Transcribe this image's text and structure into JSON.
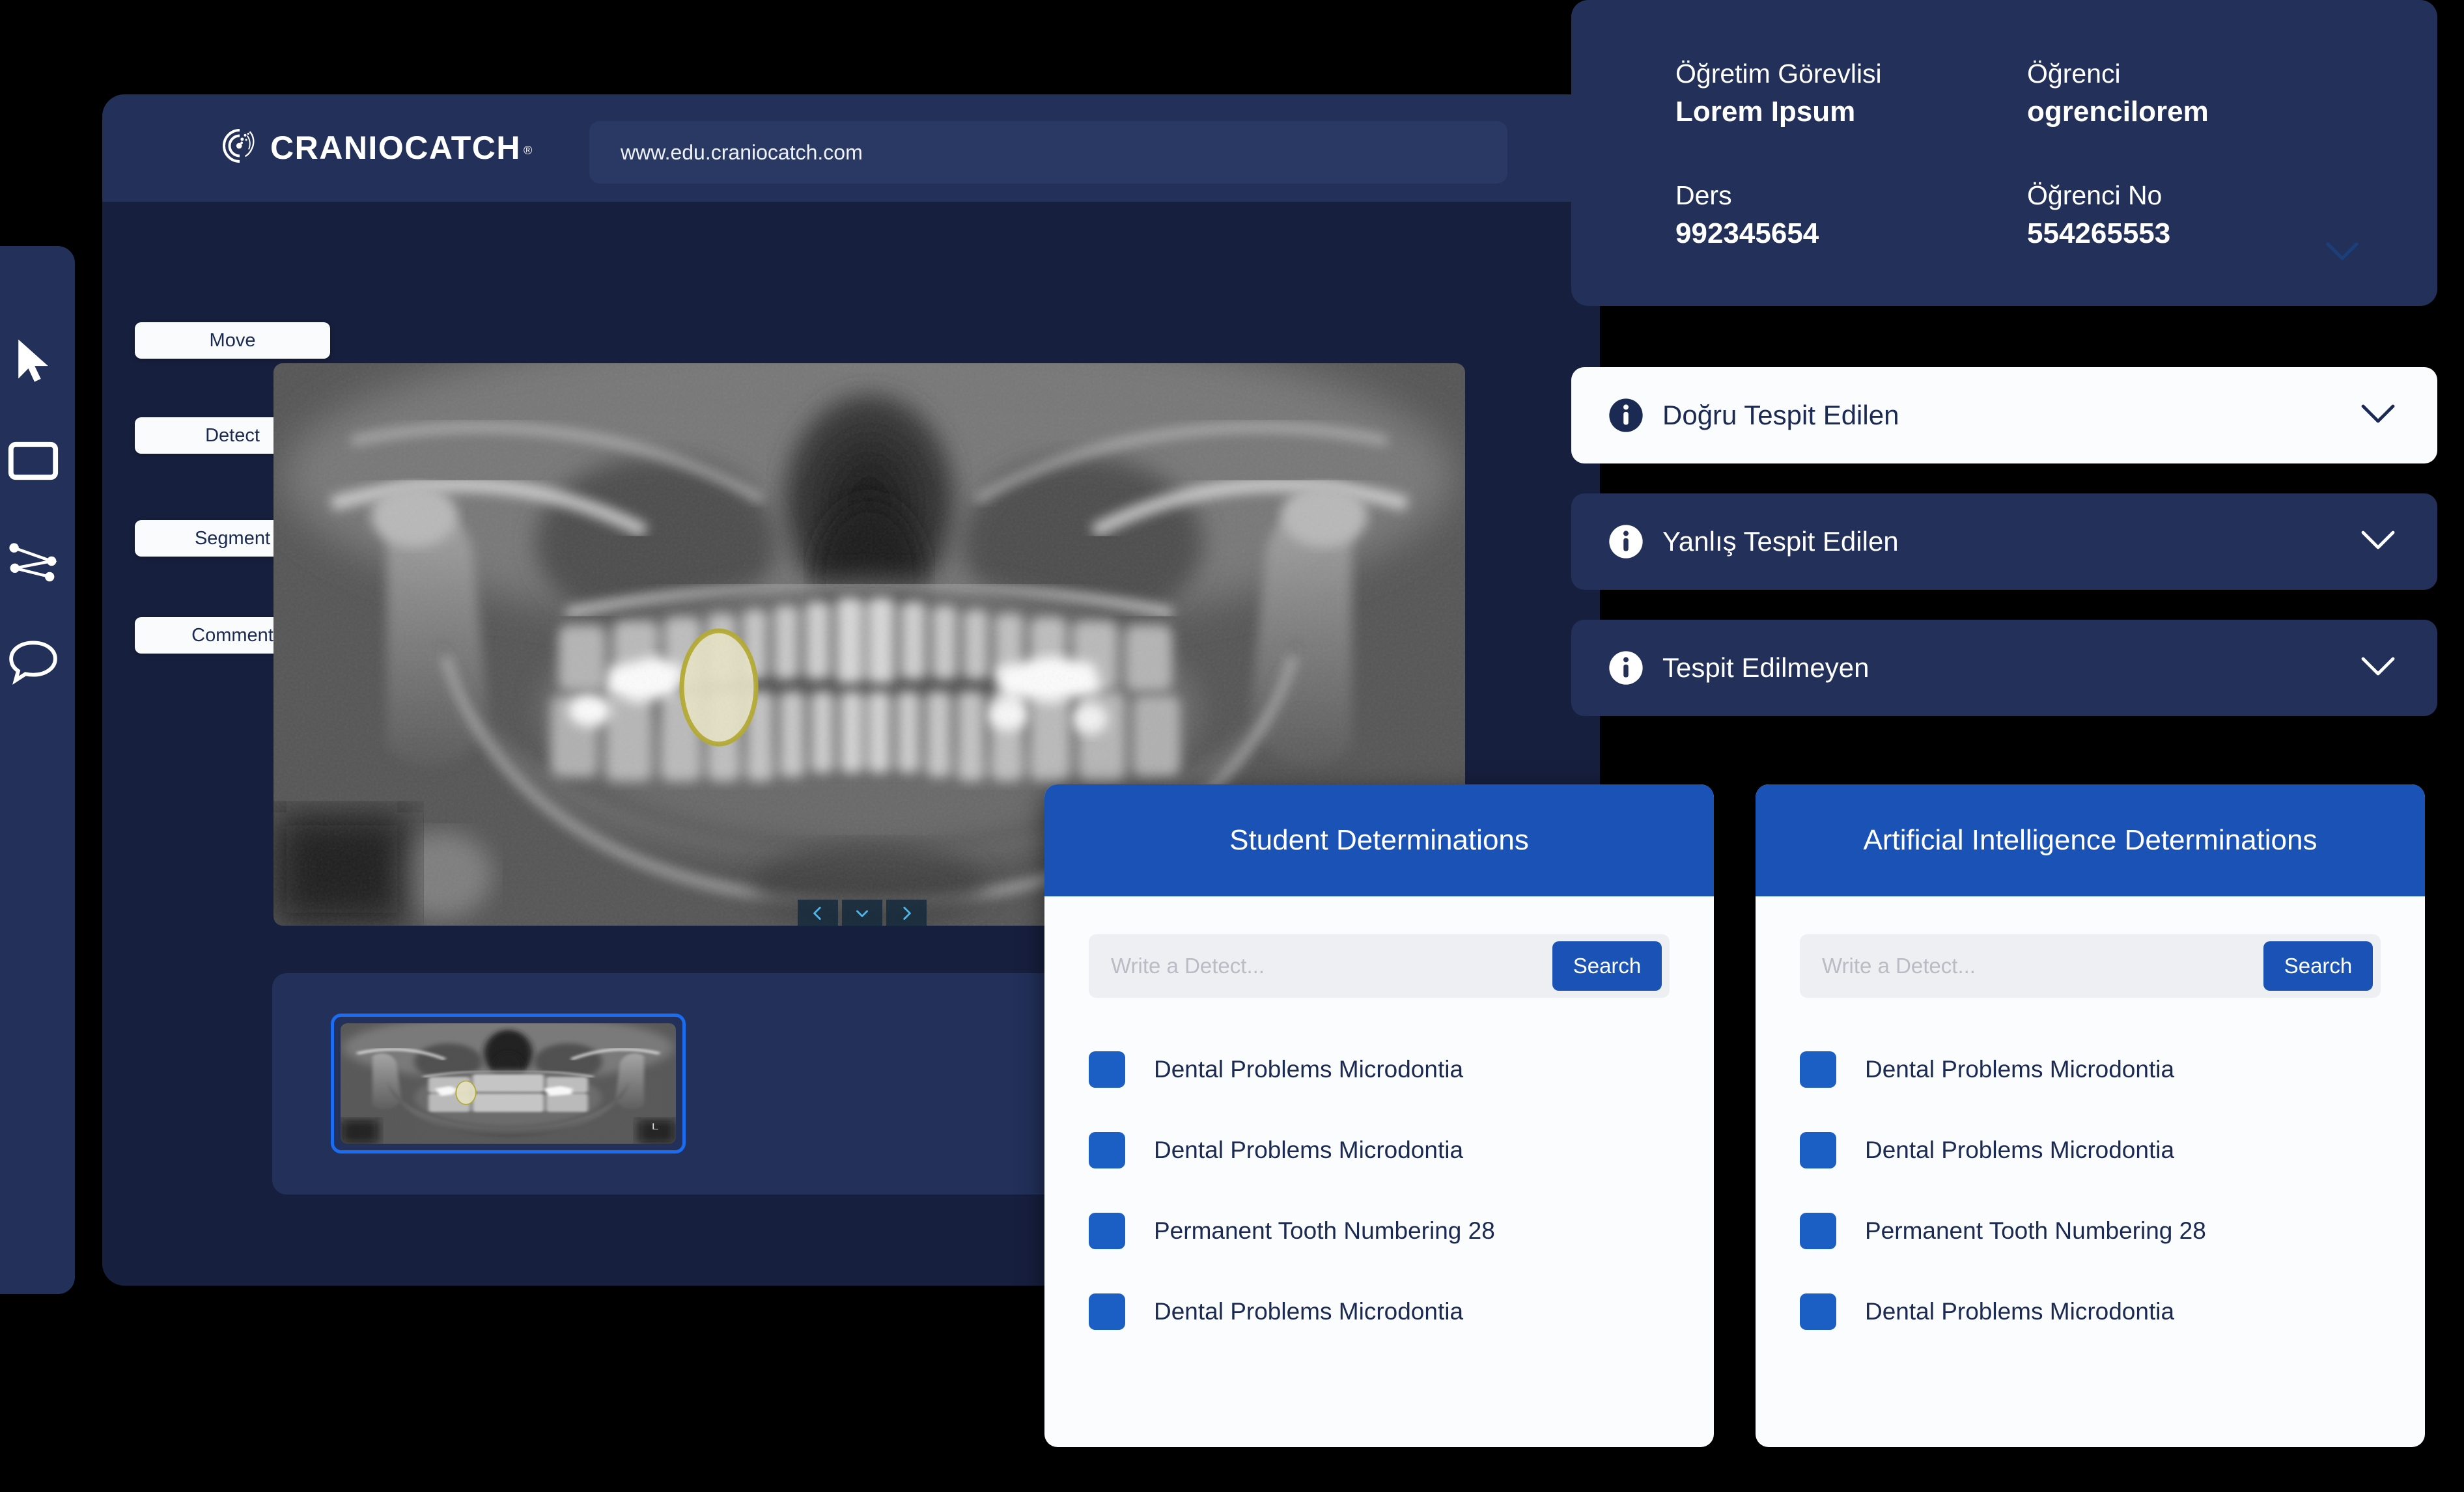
{
  "colors": {
    "page_background": "#000000",
    "panel_navy_light": "#22305a",
    "panel_navy_dark": "#171f3e",
    "accent_blue": "#1b52b5",
    "swatch_blue": "#1b5ec4",
    "selection_blue": "#1b6cf0",
    "text_navy": "#1b2a52",
    "white": "#ffffff"
  },
  "tool_rail": {
    "items": [
      {
        "icon": "cursor-arrow-icon",
        "name": "select-tool"
      },
      {
        "icon": "rectangle-icon",
        "name": "rectangle-tool"
      },
      {
        "icon": "polyline-points-icon",
        "name": "polyline-tool"
      },
      {
        "icon": "speech-bubble-icon",
        "name": "comment-tool"
      }
    ]
  },
  "header": {
    "brand_name": "CRANIOCATCH",
    "brand_registered": "®",
    "logo_icon": "craniocatch-logo-icon"
  },
  "url_bar": {
    "value": "www.edu.craniocatch.com",
    "placeholder": "www.edu.craniocatch.com"
  },
  "tools": {
    "move": "Move",
    "detect": "Detect",
    "segment": "Segment",
    "comment": "Comment"
  },
  "xray": {
    "nav": {
      "prev_icon": "chevron-left-icon",
      "down_icon": "chevron-down-icon",
      "next_icon": "chevron-right-icon"
    },
    "orientation_marker": "L"
  },
  "info_card": {
    "fields": [
      {
        "label": "Öğretim Görevlisi",
        "value": "Lorem Ipsum"
      },
      {
        "label": "Öğrenci",
        "value": "ogrencilorem"
      },
      {
        "label": "Ders",
        "value": "992345654"
      },
      {
        "label": "Öğrenci No",
        "value": "554265553"
      }
    ],
    "collapse_icon": "chevron-down-icon"
  },
  "accordions": [
    {
      "label": "Doğru Tespit Edilen",
      "icon": "info-circle-icon",
      "state": "active",
      "chevron": "chevron-down-icon"
    },
    {
      "label": "Yanlış Tespit Edilen",
      "icon": "info-circle-icon",
      "state": "inactive",
      "chevron": "chevron-down-icon"
    },
    {
      "label": "Tespit Edilmeyen",
      "icon": "info-circle-icon",
      "state": "inactive",
      "chevron": "chevron-down-icon"
    }
  ],
  "panels": {
    "student": {
      "title": "Student Determinations",
      "search_placeholder": "Write a Detect...",
      "search_value": "",
      "search_button": "Search",
      "items": [
        "Dental Problems Microdontia",
        "Dental Problems Microdontia",
        "Permanent Tooth Numbering 28",
        "Dental Problems Microdontia"
      ]
    },
    "ai": {
      "title": "Artificial Intelligence Determinations",
      "search_placeholder": "Write a Detect...",
      "search_value": "",
      "search_button": "Search",
      "items": [
        "Dental Problems Microdontia",
        "Dental Problems Microdontia",
        "Permanent Tooth Numbering 28",
        "Dental Problems Microdontia"
      ]
    }
  }
}
